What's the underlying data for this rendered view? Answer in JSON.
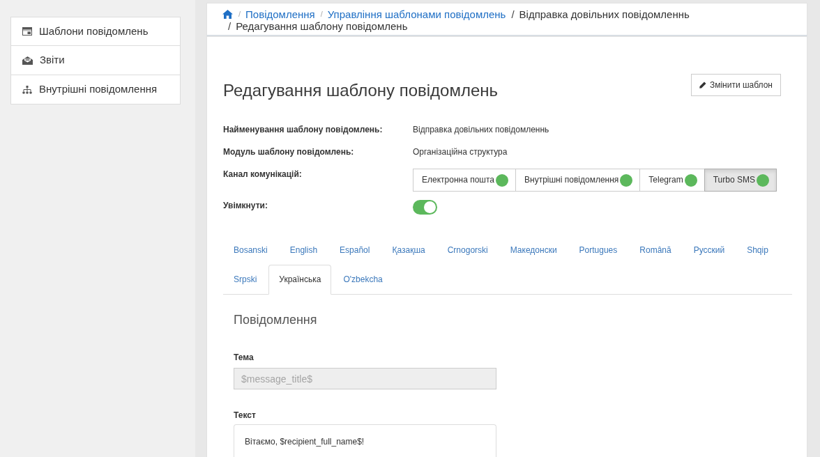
{
  "sidebar": {
    "items": [
      {
        "label": "Шаблони повідомлень",
        "selected": false
      },
      {
        "label": "Звіти",
        "selected": false
      },
      {
        "label": "Внутрішні повідомлення",
        "selected": false
      }
    ]
  },
  "breadcrumb": [
    {
      "kind": "home"
    },
    {
      "kind": "link",
      "separator": "/",
      "label": "Повідомлення"
    },
    {
      "kind": "link",
      "separator": "/",
      "label": "Управління шаблонами повідомлень"
    },
    {
      "kind": "text",
      "separator": "/",
      "label": "Відправка довільних повідомленнь"
    },
    {
      "kind": "text",
      "separator": "/",
      "label": "Редагування шаблону повідомлень"
    }
  ],
  "page": {
    "title": "Редагування шаблону повідомлень",
    "edit_button": "Змінити шаблон"
  },
  "details": [
    {
      "kind": "text",
      "label": "Найменування шаблону повідомлень:",
      "value": "Відправка довільних повідомленнь"
    },
    {
      "kind": "text",
      "label": "Модуль шаблону повідомлень:",
      "value": "Організаційна структура"
    },
    {
      "kind": "channels",
      "label": "Канал комунікацій:",
      "channels": [
        {
          "name": "Електронна пошта",
          "selected": false
        },
        {
          "name": "Внутрішні повідомлення",
          "selected": false
        },
        {
          "name": "Telegram",
          "selected": false
        },
        {
          "name": "Turbo SMS",
          "selected": true
        }
      ]
    },
    {
      "kind": "switch",
      "label": "Увімкнути:",
      "on": true
    }
  ],
  "language_tabs": [
    {
      "label": "Bosanski",
      "selected": false
    },
    {
      "label": "English",
      "selected": false
    },
    {
      "label": "Español",
      "selected": false
    },
    {
      "label": "Қазақша",
      "selected": false
    },
    {
      "label": "Crnogorski",
      "selected": false
    },
    {
      "label": "Македонски",
      "selected": false
    },
    {
      "label": "Portugues",
      "selected": false
    },
    {
      "label": "Română",
      "selected": false
    },
    {
      "label": "Русский",
      "selected": false
    },
    {
      "label": "Shqip",
      "selected": false
    },
    {
      "label": "Srpski",
      "selected": false
    },
    {
      "label": "Українська",
      "selected": true
    },
    {
      "label": "O'zbekcha",
      "selected": false
    }
  ],
  "message": {
    "heading": "Повідомлення",
    "fields": [
      {
        "kind": "input",
        "label": "Тема",
        "placeholder": "$message_title$",
        "disabled": true
      },
      {
        "kind": "editor",
        "label": "Текст",
        "value": "Вітаємо, $recipient_full_name$!"
      }
    ]
  }
}
